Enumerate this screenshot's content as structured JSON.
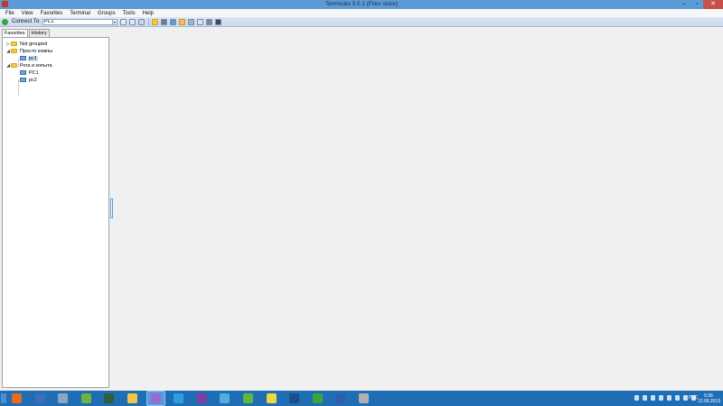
{
  "window": {
    "title": "Terminals 3.0.1 (Files store)",
    "controls": {
      "minimize": "–",
      "maximize": "▫",
      "close": "✕"
    }
  },
  "menubar": {
    "items": [
      "File",
      "View",
      "Favorites",
      "Terminal",
      "Groups",
      "Tools",
      "Help"
    ]
  },
  "toolbar": {
    "connect_label": "Connect To:",
    "connect_value": "PC1",
    "dropdown_arrow": "▾",
    "button_icons": [
      "new-connection-icon",
      "save-icon",
      "edit-icon",
      "favorite-star-icon",
      "group-icon",
      "fullscreen-icon",
      "keyboard-icon",
      "split-icon",
      "ping-icon",
      "network-icon",
      "screenshot-icon"
    ]
  },
  "leftpanel": {
    "tabs": [
      "Favorites",
      "History"
    ],
    "active_tab": "Favorites",
    "tree": {
      "groups": [
        {
          "label": "Not grouped",
          "expander": "▷",
          "children": []
        },
        {
          "label": "Просто компы",
          "expander": "◢",
          "children": [
            {
              "label": "pc1",
              "selected": true
            }
          ]
        },
        {
          "label": "Рога и копыта",
          "expander": "◢",
          "children": [
            {
              "label": "PC1",
              "selected": false
            },
            {
              "label": "pc2",
              "selected": false
            }
          ]
        }
      ]
    }
  },
  "taskbar": {
    "apps": [
      {
        "name": "firefox-icon",
        "color": "#e66a1f",
        "active": false
      },
      {
        "name": "thunderbird-icon",
        "color": "#3c6fb6",
        "active": false
      },
      {
        "name": "app-window-icon",
        "color": "#8aa6c0",
        "active": false
      },
      {
        "name": "notepad-icon",
        "color": "#6db33f",
        "active": false
      },
      {
        "name": "terminal-grid-icon",
        "color": "#2e5e3a",
        "active": false
      },
      {
        "name": "file-explorer-icon",
        "color": "#f3c24d",
        "active": false
      },
      {
        "name": "terminals-app-icon",
        "color": "#9b6bd1",
        "active": true
      },
      {
        "name": "internet-explorer-icon",
        "color": "#2f9be0",
        "active": false
      },
      {
        "name": "floppy-icon",
        "color": "#7b3fa0",
        "active": false
      },
      {
        "name": "files-icon",
        "color": "#4fb0d8",
        "active": false
      },
      {
        "name": "calendar-app-icon",
        "color": "#5fb83b",
        "active": false
      },
      {
        "name": "sun-icon",
        "color": "#f0d640",
        "active": false
      },
      {
        "name": "circle-app-icon",
        "color": "#1b4f8a",
        "active": false
      },
      {
        "name": "utorrent-icon",
        "color": "#3aa53a",
        "active": false
      },
      {
        "name": "document-app-icon",
        "color": "#2b5fa8",
        "active": false
      },
      {
        "name": "tools-icon",
        "color": "#b0b0b0",
        "active": false
      }
    ],
    "lang": "РУС",
    "time": "0:36",
    "date": "12.06.2013"
  }
}
